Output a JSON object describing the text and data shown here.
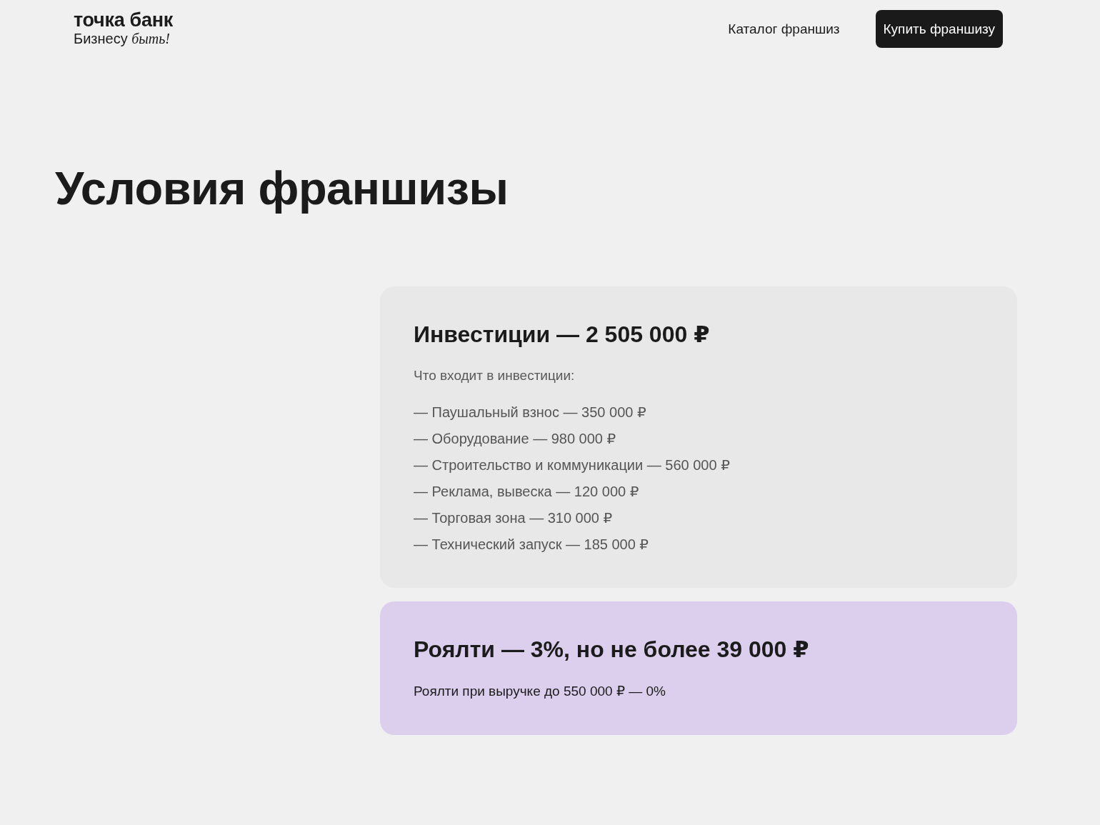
{
  "header": {
    "logo": {
      "name": "точка банк",
      "tagline": "Бизнесу *быть!*"
    },
    "nav_links": [
      {
        "label": "Каталог франшиз"
      }
    ],
    "cta_button": {
      "label": "Купить франшизу"
    }
  },
  "page_title": "Условия франшизы",
  "cards": [
    {
      "kind": "investments",
      "title": "Инвестиции — 2 505 000 ₽",
      "subtitle": "Что входит в инвестиции:",
      "items": [
        "— Паушальный взнос — 350 000 ₽",
        "— Оборудование — 980 000 ₽",
        "— Строительство и коммуникации — 560 000 ₽",
        "— Реклама, вывеска — 120 000 ₽",
        "— Торговая зона — 310 000 ₽",
        "— Технический запуск — 185 000 ₽"
      ]
    },
    {
      "kind": "royalty",
      "title": "Роялти — 3%, но не более 39 000 ₽",
      "note": "Роялти при выручке до 550 000 ₽ — 0%"
    }
  ]
}
